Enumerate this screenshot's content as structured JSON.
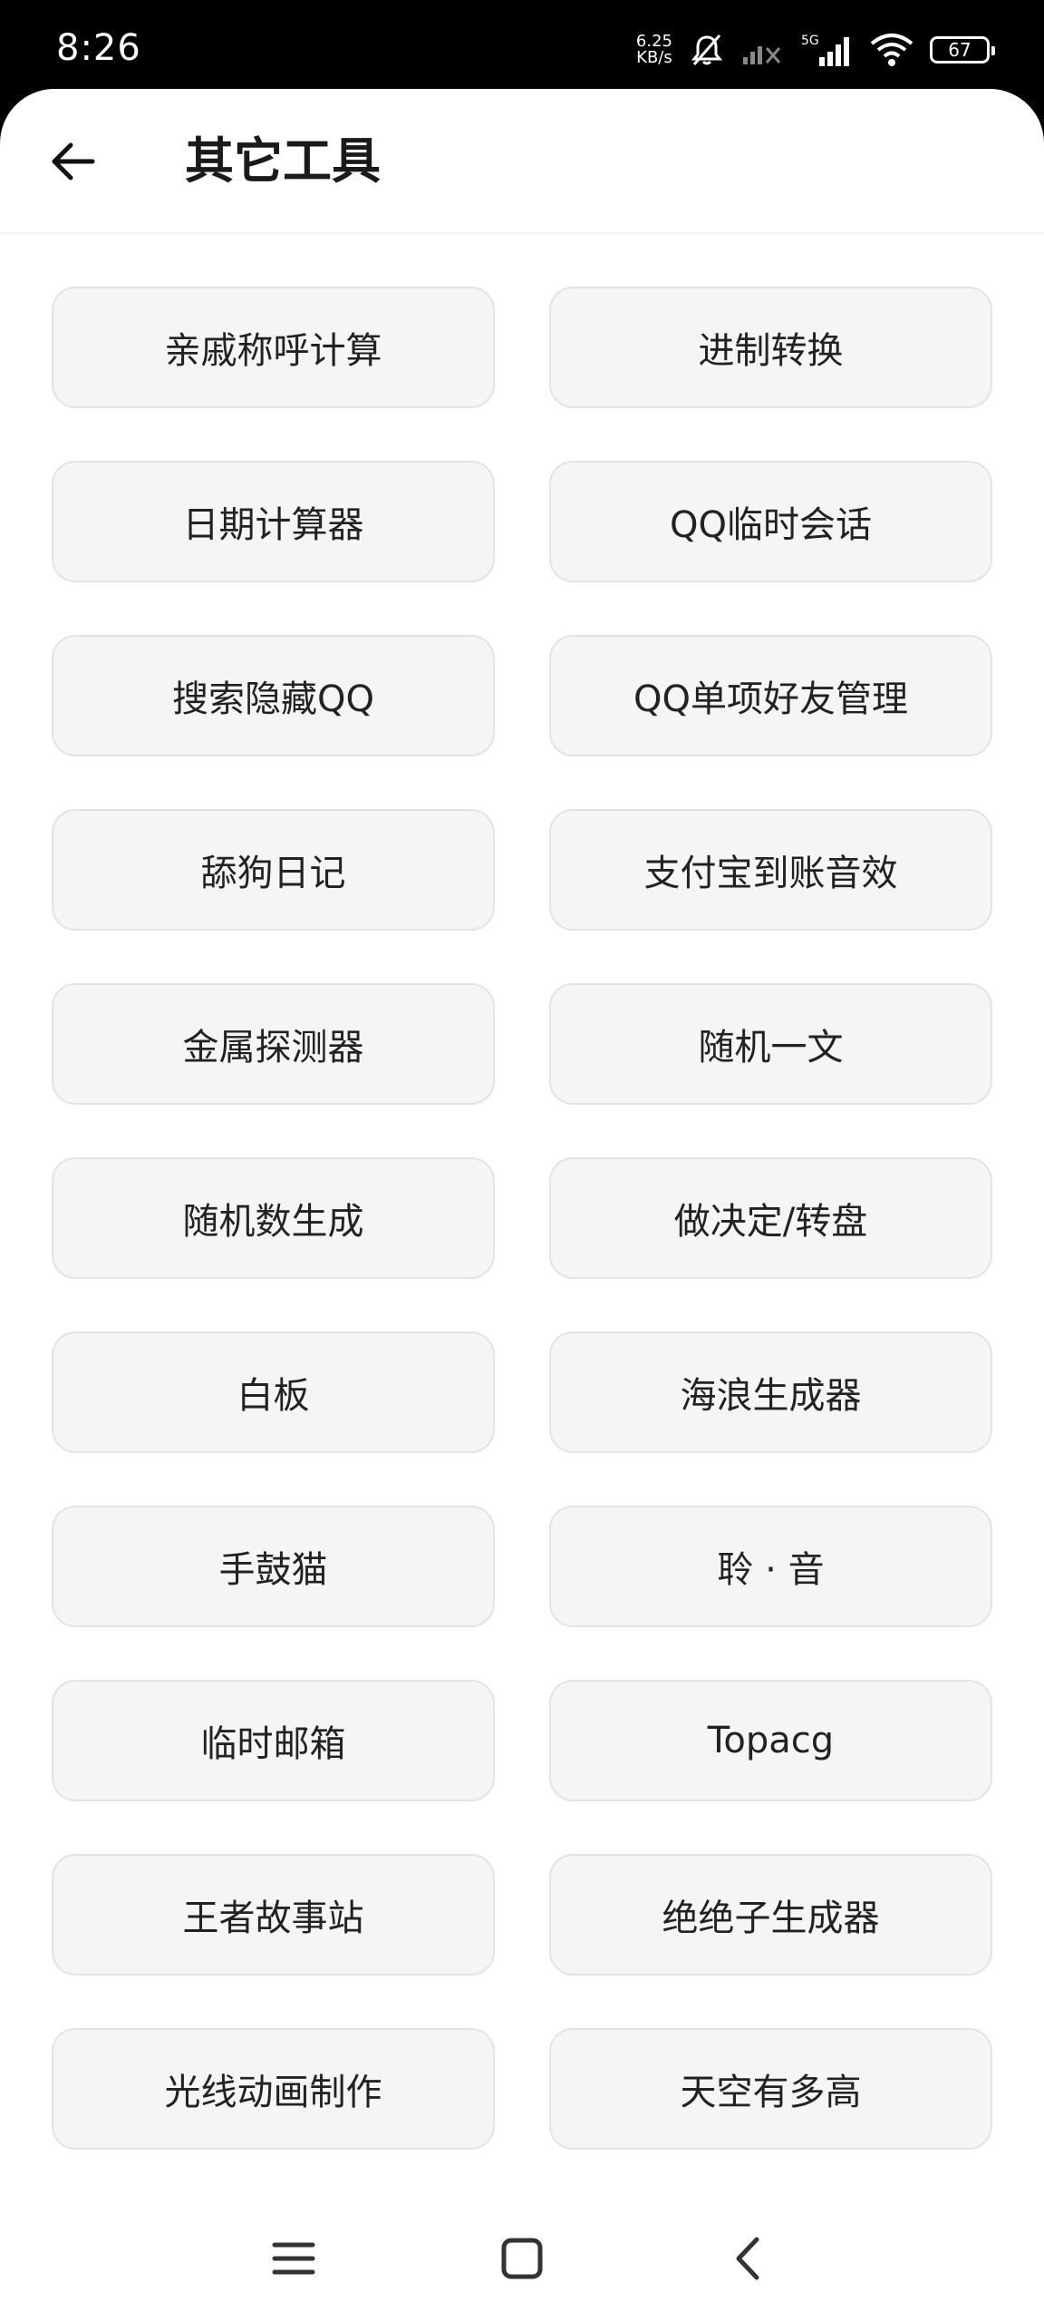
{
  "status_bar": {
    "time": "8:26",
    "net_speed_value": "6.25",
    "net_speed_unit": "KB/s",
    "network_type": "5G",
    "battery": "67",
    "icons": [
      "mute-icon",
      "signal-off-icon",
      "signal-icon",
      "wifi-icon",
      "battery-icon"
    ]
  },
  "header": {
    "title": "其它工具",
    "back_icon": "arrow-left-icon"
  },
  "tools": [
    {
      "label": "亲戚称呼计算"
    },
    {
      "label": "进制转换"
    },
    {
      "label": "日期计算器"
    },
    {
      "label": "QQ临时会话"
    },
    {
      "label": "搜索隐藏QQ"
    },
    {
      "label": "QQ单项好友管理"
    },
    {
      "label": "舔狗日记"
    },
    {
      "label": "支付宝到账音效"
    },
    {
      "label": "金属探测器"
    },
    {
      "label": "随机一文"
    },
    {
      "label": "随机数生成"
    },
    {
      "label": "做决定/转盘"
    },
    {
      "label": "白板"
    },
    {
      "label": "海浪生成器"
    },
    {
      "label": "手鼓猫"
    },
    {
      "label": "聆 · 音"
    },
    {
      "label": "临时邮箱"
    },
    {
      "label": "Topacg"
    },
    {
      "label": "王者故事站"
    },
    {
      "label": "绝绝子生成器"
    },
    {
      "label": "光线动画制作"
    },
    {
      "label": "天空有多高"
    }
  ],
  "nav_bar": {
    "icons": [
      "menu-icon",
      "home-icon",
      "back-nav-icon"
    ]
  },
  "colors": {
    "button_bg": "#f5f5f5",
    "button_border": "#e3e3e3",
    "text": "#222222",
    "status_bg": "#000000"
  }
}
